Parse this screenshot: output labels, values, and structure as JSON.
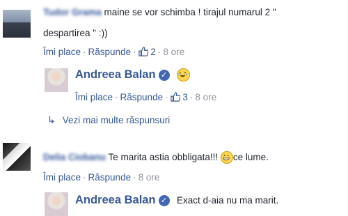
{
  "comments": [
    {
      "author": "Tudor Grama",
      "text_line1": "maine se vor schimba ! tirajul numarul 2 \"",
      "text_line2": "despartirea \" :))",
      "like_label": "Îmi place",
      "reply_label": "Răspunde",
      "likes": "2",
      "time": "8 ore"
    },
    {
      "author": "Andreea Balan",
      "like_label": "Îmi place",
      "reply_label": "Răspunde",
      "likes": "3",
      "time": "8 ore"
    },
    {
      "more_replies": "Vezi mai multe răspunsuri"
    },
    {
      "author": "Delia Ciobanu",
      "text": "Te marita astia obbligata!!!",
      "text_after_emoji": "ce lume.",
      "like_label": "Îmi place",
      "reply_label": "Răspunde",
      "time": "8 ore"
    },
    {
      "author": "Andreea Balan",
      "text": "Exact d-aia nu ma marit."
    }
  ],
  "icons": {
    "like": "thumbs-up-icon",
    "verified": "verified-check-icon",
    "emoji": "grinning-emoji-icon",
    "arrow": "reply-arrow-icon"
  },
  "colors": {
    "link": "#365899",
    "muted": "#90949c",
    "verified": "#4267b2"
  }
}
